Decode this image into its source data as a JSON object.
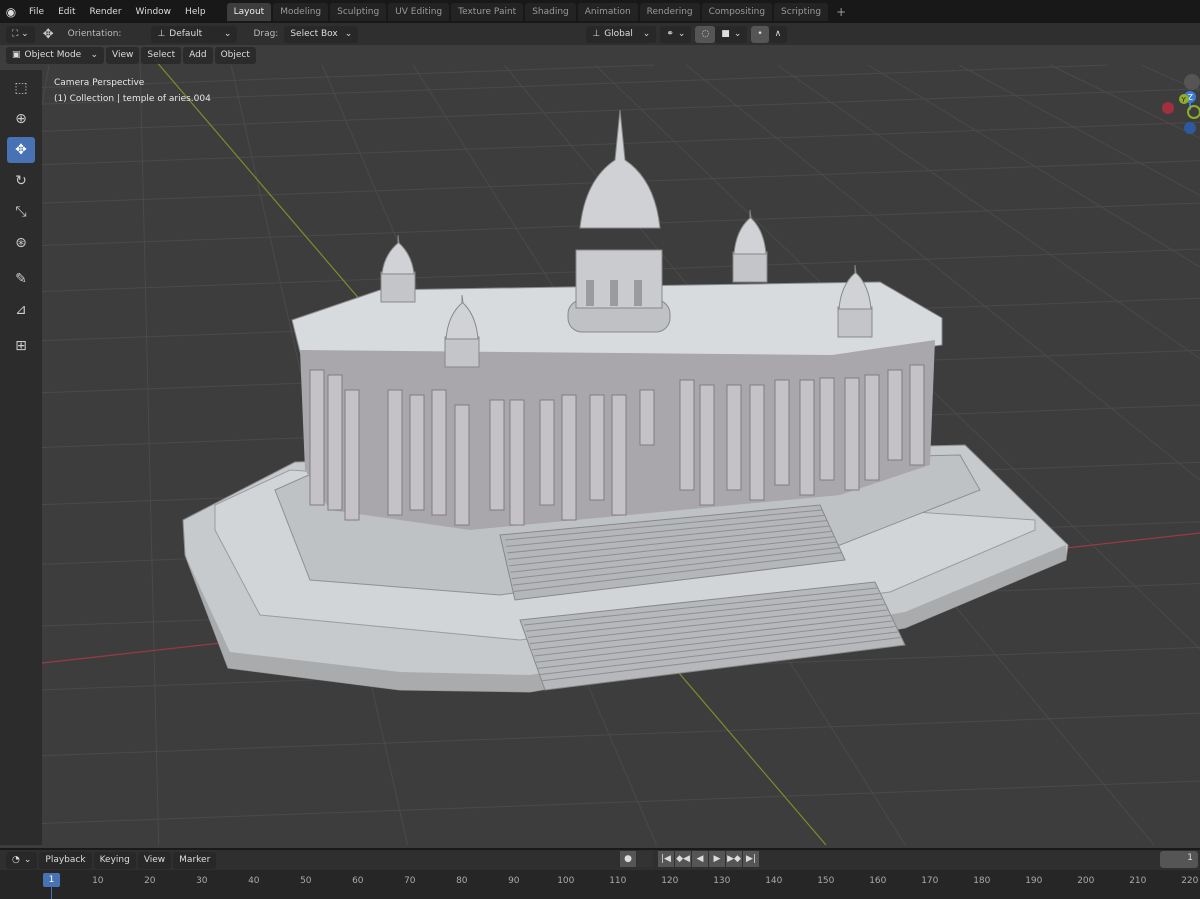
{
  "menu": [
    "File",
    "Edit",
    "Render",
    "Window",
    "Help"
  ],
  "workspaces": [
    {
      "label": "Layout",
      "active": true
    },
    {
      "label": "Modeling"
    },
    {
      "label": "Sculpting"
    },
    {
      "label": "UV Editing"
    },
    {
      "label": "Texture Paint"
    },
    {
      "label": "Shading"
    },
    {
      "label": "Animation"
    },
    {
      "label": "Rendering"
    },
    {
      "label": "Compositing"
    },
    {
      "label": "Scripting"
    }
  ],
  "add_tab": "+",
  "tool_header": {
    "orientation_label": "Orientation:",
    "orientation_value": "Default",
    "drag_label": "Drag:",
    "drag_value": "Select Box",
    "transform_orientation": "Global"
  },
  "viewport_header": {
    "mode": "Object Mode",
    "items": [
      "View",
      "Select",
      "Add",
      "Object"
    ]
  },
  "overlay": {
    "view": "Camera Perspective",
    "collection": "(1) Collection | temple of aries.004"
  },
  "tools": [
    "select-box",
    "cursor",
    "move",
    "rotate",
    "scale",
    "transform",
    "annotate",
    "measure",
    "add-cube"
  ],
  "gizmo_axes": {
    "z": "Z",
    "y": "Y"
  },
  "colors": {
    "accent": "#4772b3",
    "x_axis": "#c4384a",
    "y_axis": "#8db028",
    "z_axis": "#3b7bd6"
  },
  "timeline": {
    "items": [
      "Playback",
      "Keying",
      "View",
      "Marker"
    ],
    "current_frame": "1",
    "frame_field": "1",
    "ticks": [
      "10",
      "20",
      "30",
      "40",
      "50",
      "60",
      "70",
      "80",
      "90",
      "100",
      "110",
      "120",
      "130",
      "140",
      "150",
      "160",
      "170",
      "180",
      "190",
      "200",
      "210",
      "220"
    ]
  }
}
